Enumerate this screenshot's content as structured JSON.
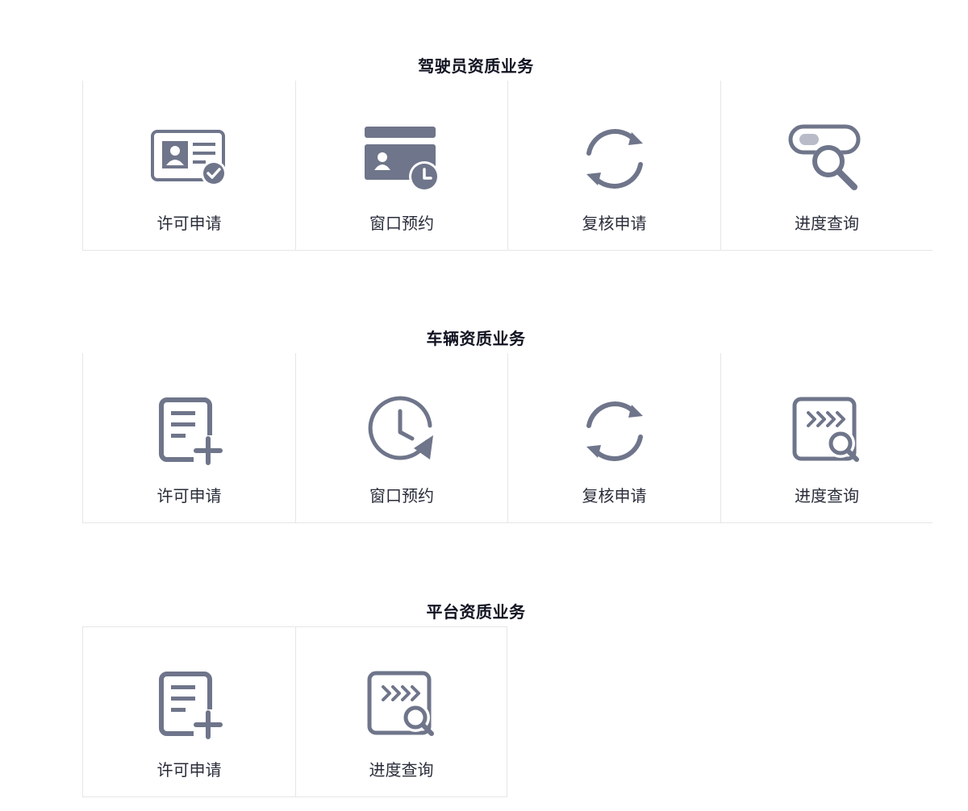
{
  "sections": [
    {
      "title": "驾驶员资质业务",
      "items": [
        {
          "label": "许可申请",
          "icon": "id-card-check-icon"
        },
        {
          "label": "窗口预约",
          "icon": "card-clock-icon"
        },
        {
          "label": "复核申请",
          "icon": "refresh-icon"
        },
        {
          "label": "进度查询",
          "icon": "toggle-search-icon"
        }
      ]
    },
    {
      "title": "车辆资质业务",
      "items": [
        {
          "label": "许可申请",
          "icon": "document-add-icon"
        },
        {
          "label": "窗口预约",
          "icon": "clock-arrow-icon"
        },
        {
          "label": "复核申请",
          "icon": "refresh-icon"
        },
        {
          "label": "进度查询",
          "icon": "progress-search-icon"
        }
      ]
    },
    {
      "title": "平台资质业务",
      "items": [
        {
          "label": "许可申请",
          "icon": "document-add-icon"
        },
        {
          "label": "进度查询",
          "icon": "progress-search-icon"
        }
      ]
    }
  ],
  "colors": {
    "icon": "#6f758a",
    "border": "#e6e6e9",
    "title": "#111321",
    "label": "#2a2d3a"
  }
}
